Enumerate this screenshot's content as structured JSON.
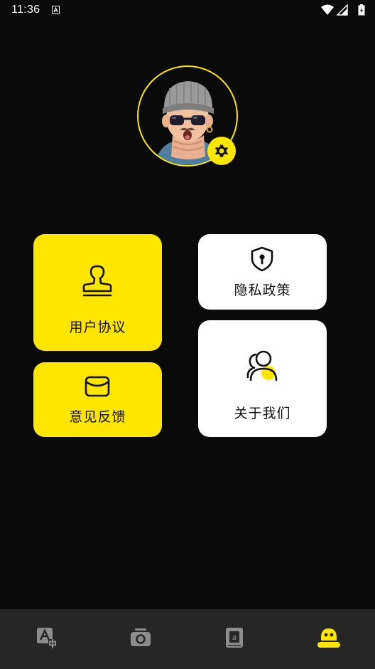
{
  "status_bar": {
    "time": "11:36"
  },
  "profile": {
    "avatar_icon": "avatar-3d-character",
    "settings_icon": "gear-icon"
  },
  "cards": {
    "agreement": {
      "label": "用户协议",
      "icon": "stamp-icon"
    },
    "feedback": {
      "label": "意见反馈",
      "icon": "envelope-icon"
    },
    "privacy": {
      "label": "隐私政策",
      "icon": "shield-keyhole-icon"
    },
    "about": {
      "label": "关于我们",
      "icon": "users-icon"
    }
  },
  "bottom_nav": {
    "items": [
      {
        "icon": "translate-icon",
        "active": false
      },
      {
        "icon": "camera-icon",
        "active": false
      },
      {
        "icon": "book-icon",
        "active": false
      },
      {
        "icon": "profile-face-icon",
        "active": true
      }
    ]
  },
  "colors": {
    "accent": "#ffe600",
    "background": "#0a0a0a",
    "card_white": "#ffffff",
    "nav_background": "#262626",
    "nav_inactive": "#8c8c8c"
  }
}
